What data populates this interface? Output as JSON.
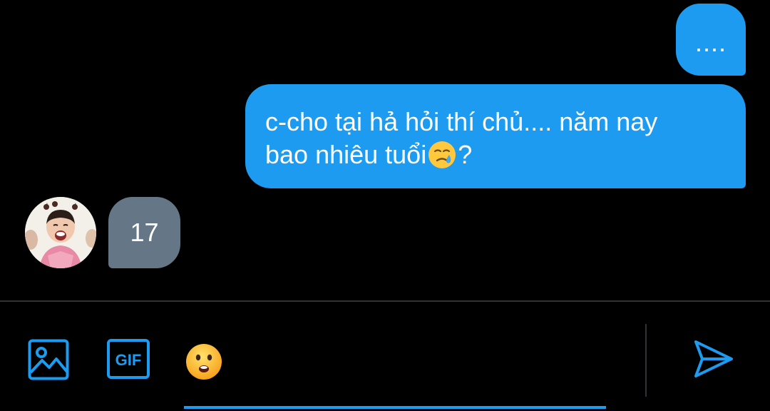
{
  "conversation": {
    "messages": [
      {
        "direction": "outgoing",
        "text": "...."
      },
      {
        "direction": "outgoing",
        "line1": "c-cho tại hả hỏi thí chủ.... năm nay",
        "line2_before_emoji": "bao nhiêu tuổi",
        "emoji": "face-holding-back-tears",
        "line2_after_emoji": "?"
      },
      {
        "direction": "incoming",
        "text": "17",
        "avatar": "user-avatar-photo"
      }
    ]
  },
  "composer": {
    "placeholder": "",
    "value": "",
    "icons": [
      "image-icon",
      "gif-icon",
      "frowning-face-emoji-icon",
      "send-icon"
    ],
    "gif_label": "GIF"
  },
  "colors": {
    "background": "#000000",
    "accent": "#1d9bf0",
    "incoming_bubble": "#657786",
    "divider": "#2f3336"
  }
}
